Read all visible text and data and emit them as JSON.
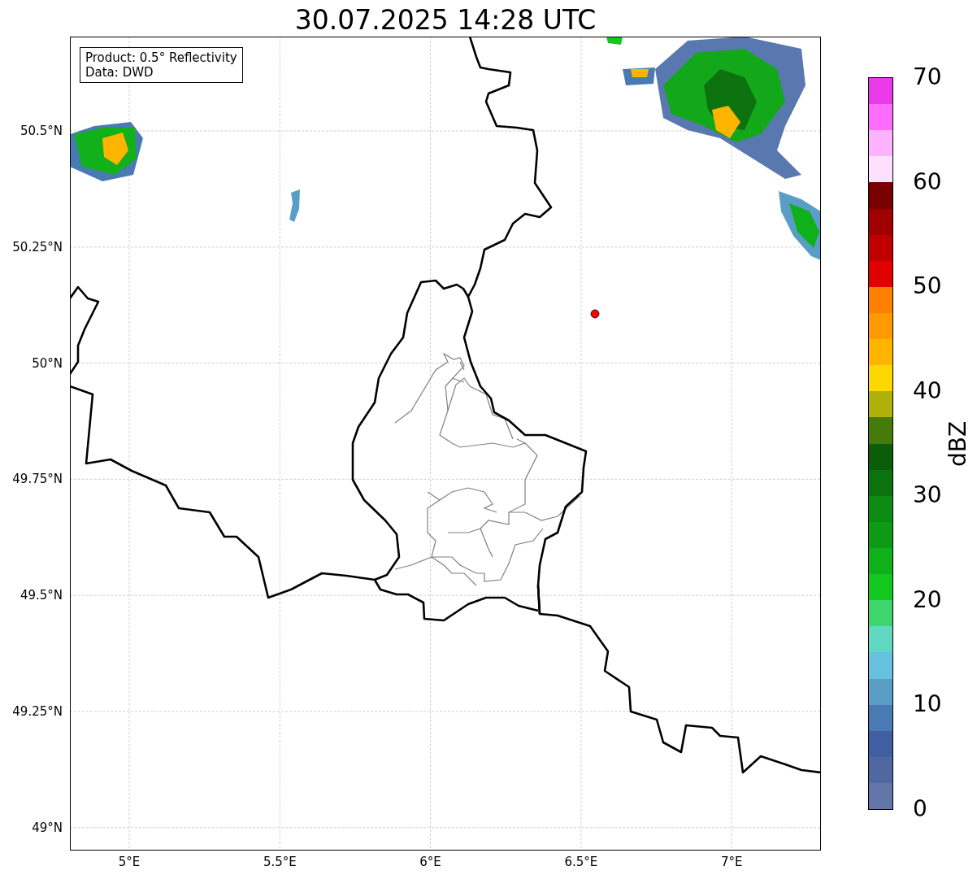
{
  "title": "30.07.2025 14:28 UTC",
  "legend": [
    "Product: 0.5° Reflectivity",
    "Data: DWD"
  ],
  "map": {
    "yticks": [
      "50.5°N",
      "50.25°N",
      "50°N",
      "49.75°N",
      "49.5°N",
      "49.25°N",
      "49°N"
    ],
    "xticks": [
      "5°E",
      "5.5°E",
      "6°E",
      "6.5°E",
      "7°E"
    ]
  },
  "colorbar": {
    "label": "dBZ",
    "ticks": [
      "70",
      "60",
      "50",
      "40",
      "30",
      "20",
      "10",
      "0"
    ],
    "bins": [
      {
        "color": "#ea3aea"
      },
      {
        "color": "#ff6cff"
      },
      {
        "color": "#ffb2ff"
      },
      {
        "color": "#ffe0ff"
      },
      {
        "color": "#780000"
      },
      {
        "color": "#a00000"
      },
      {
        "color": "#c00000"
      },
      {
        "color": "#e20000"
      },
      {
        "color": "#ff7f00"
      },
      {
        "color": "#ff9a00"
      },
      {
        "color": "#ffb400"
      },
      {
        "color": "#ffd700"
      },
      {
        "color": "#b0b00a"
      },
      {
        "color": "#467a0a"
      },
      {
        "color": "#0a5e0a"
      },
      {
        "color": "#0b720e"
      },
      {
        "color": "#0c8a12"
      },
      {
        "color": "#0d9a15"
      },
      {
        "color": "#0fb01a"
      },
      {
        "color": "#12c81e"
      },
      {
        "color": "#3ed66c"
      },
      {
        "color": "#60d8c4"
      },
      {
        "color": "#66c2de"
      },
      {
        "color": "#5a9ec8"
      },
      {
        "color": "#4a7ab4"
      },
      {
        "color": "#405fa2"
      },
      {
        "color": "#5068a0"
      },
      {
        "color": "#6476a8"
      }
    ]
  }
}
